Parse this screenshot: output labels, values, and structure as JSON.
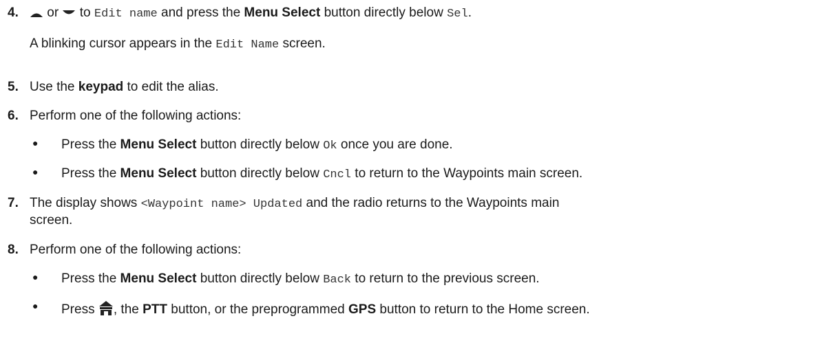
{
  "steps": {
    "s4": {
      "num": "4.",
      "or": "or",
      "to": "to",
      "code1": "Edit name",
      "mid": "and press the",
      "bold": "Menu Select",
      "after": "button directly below",
      "code2": "Sel",
      "end": ".",
      "note_pre": "A blinking cursor appears in the",
      "note_code": "Edit Name",
      "note_post": "screen."
    },
    "s5": {
      "num": "5.",
      "pre": "Use the",
      "bold": "keypad",
      "post": "to edit the alias."
    },
    "s6": {
      "num": "6.",
      "text": "Perform one of the following actions:",
      "b1": {
        "pre": "Press the",
        "bold": "Menu Select",
        "mid": "button directly below",
        "code": "Ok",
        "post": "once you are done."
      },
      "b2": {
        "pre": "Press the",
        "bold": "Menu Select",
        "mid": "button directly below",
        "code": "Cncl",
        "post": "to return to the Waypoints main screen."
      }
    },
    "s7": {
      "num": "7.",
      "pre": "The display shows",
      "code": "<Waypoint name> Updated",
      "post": "and the radio returns to the Waypoints main",
      "line2": "screen."
    },
    "s8": {
      "num": "8.",
      "text": "Perform one of the following actions:",
      "b1": {
        "pre": "Press the",
        "bold": "Menu Select",
        "mid": "button directly below",
        "code": "Back",
        "post": "to return to the previous screen."
      },
      "b2": {
        "pre": "Press",
        "mid1": ", the",
        "bold1": "PTT",
        "mid2": "button, or the preprogrammed",
        "bold2": "GPS",
        "post": "button to return to the Home screen."
      }
    }
  },
  "bullet_char": "●",
  "icons": {
    "up": "up-arrow-icon",
    "down": "down-arrow-icon",
    "home": "home-icon"
  }
}
